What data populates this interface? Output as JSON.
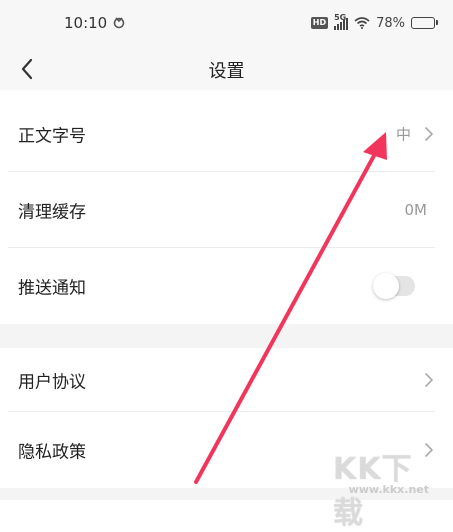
{
  "status_bar": {
    "time": "10:10",
    "hd_label": "HD",
    "network": "5G",
    "battery_percent": "78%",
    "battery_level": 0.78
  },
  "nav": {
    "title": "设置"
  },
  "settings": {
    "font_size": {
      "label": "正文字号",
      "value": "中"
    },
    "clear_cache": {
      "label": "清理缓存",
      "value": "0M"
    },
    "push_notify": {
      "label": "推送通知",
      "enabled": false
    },
    "user_agreement": {
      "label": "用户协议"
    },
    "privacy_policy": {
      "label": "隐私政策"
    }
  },
  "watermark": {
    "brand": "KK下载",
    "url": "www.kkx.net"
  },
  "colors": {
    "arrow": "#f2355a",
    "header_bg": "#f7f7f7",
    "divider": "#ececec"
  }
}
